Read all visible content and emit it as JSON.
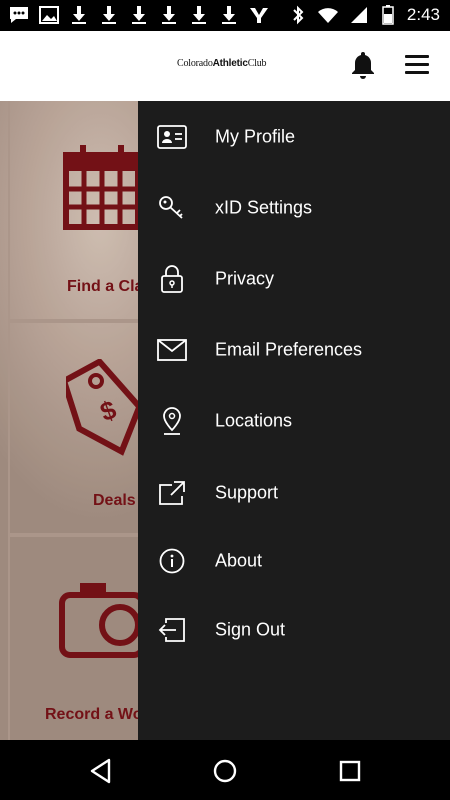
{
  "status_bar": {
    "time": "2:43",
    "left_icons": [
      "chat-icon",
      "image-icon",
      "download-icon",
      "download-icon",
      "download-icon",
      "download-icon",
      "download-icon",
      "download-icon",
      "ymca-icon"
    ],
    "right_icons": [
      "bluetooth-icon",
      "wifi-icon",
      "signal-icon",
      "battery-icon"
    ]
  },
  "header": {
    "logo_text_1": "Colorado",
    "logo_text_2": "Athletic",
    "logo_text_3": "Club"
  },
  "background": {
    "tiles": [
      {
        "label": "Find a Cla",
        "icon": "calendar-icon"
      },
      {
        "label": "Deals",
        "icon": "price-tag-icon"
      },
      {
        "label": "Record a Wo",
        "icon": "camera-icon"
      }
    ],
    "accent_color": "#7a1218"
  },
  "drawer": {
    "background": "#1c1c1c",
    "items": [
      {
        "label": "My Profile",
        "icon": "id-card-icon"
      },
      {
        "label": "xID Settings",
        "icon": "key-icon"
      },
      {
        "label": "Privacy",
        "icon": "lock-icon"
      },
      {
        "label": "Email Preferences",
        "icon": "envelope-icon"
      },
      {
        "label": "Locations",
        "icon": "location-pin-icon"
      },
      {
        "label": "Support",
        "icon": "external-link-icon"
      },
      {
        "label": "About",
        "icon": "info-icon"
      },
      {
        "label": "Sign Out",
        "icon": "sign-out-icon"
      }
    ]
  },
  "nav_bar": {
    "buttons": [
      "back-icon",
      "home-icon",
      "recents-icon"
    ]
  }
}
